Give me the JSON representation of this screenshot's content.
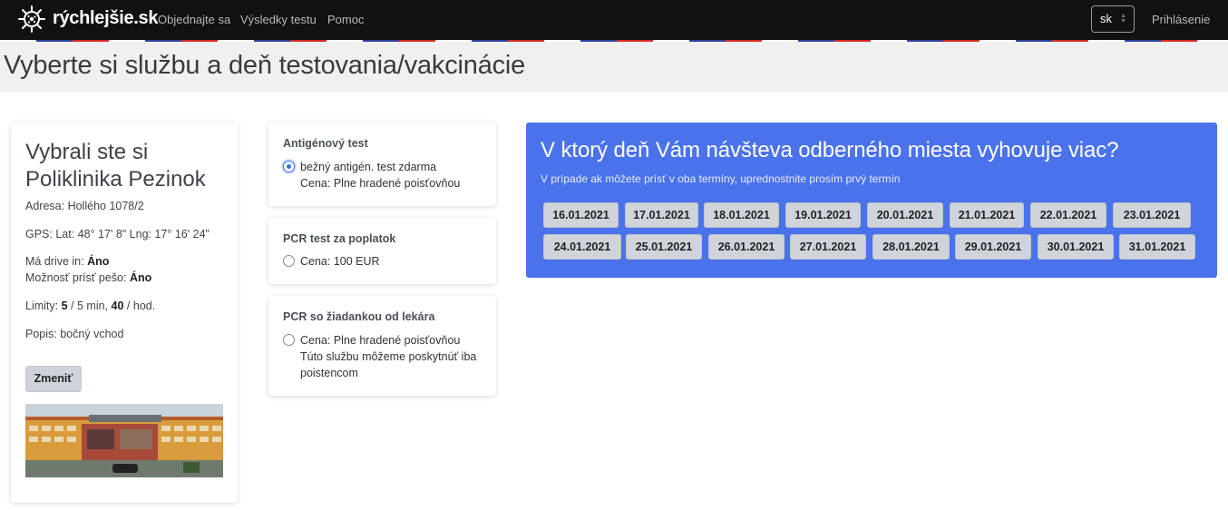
{
  "navbar": {
    "brand": "rýchlejšie.sk",
    "links": [
      "Objednajte sa",
      "Výsledky testu",
      "Pomoc"
    ],
    "language": "sk",
    "login": "Prihlásenie"
  },
  "page_title": "Vyberte si službu a deň testovania/vakcinácie",
  "location": {
    "heading_line1": "Vybrali ste si",
    "heading_line2": "Poliklinika Pezinok",
    "address_label": "Adresa:",
    "address": "Hollého 1078/2",
    "gps_label": "GPS:",
    "gps": "Lat: 48° 17' 8\" Lng: 17° 16' 24\"",
    "drive_in_label": "Má drive in:",
    "drive_in": "Áno",
    "walk_in_label": "Možnosť prísť pešo:",
    "walk_in": "Áno",
    "limits_label": "Limity:",
    "limit_count": "5",
    "limit_rest": "/ 5 min,",
    "limit_hourly": "40",
    "limit_hourly_unit": "/ hod.",
    "description_label": "Popis:",
    "description": "bočný vchod",
    "change_button": "Zmeniť"
  },
  "services": [
    {
      "title": "Antigénový test",
      "selected": true,
      "lines": [
        "bežný antigén. test zdarma",
        "Cena: Plne hradené poisťovňou"
      ]
    },
    {
      "title": "PCR test za poplatok",
      "selected": false,
      "lines": [
        "Cena: 100 EUR"
      ]
    },
    {
      "title": "PCR so žiadankou od lekára",
      "selected": false,
      "lines": [
        "Cena: Plne hradené poisťovňou",
        "Túto službu môžeme poskytnúť iba",
        "poistencom"
      ]
    }
  ],
  "dates": {
    "heading": "V ktorý deň Vám návšteva odberného miesta vyhovuje viac?",
    "subheading": "V prípade ak môžete prísť v oba termíny, uprednostnite prosím prvý termín",
    "row1": [
      "16.01.2021",
      "17.01.2021",
      "18.01.2021",
      "19.01.2021",
      "20.01.2021",
      "21.01.2021",
      "22.01.2021",
      "23.01.2021"
    ],
    "row2": [
      "24.01.2021",
      "25.01.2021",
      "26.01.2021",
      "27.01.2021",
      "28.01.2021",
      "29.01.2021",
      "30.01.2021",
      "31.01.2021"
    ]
  },
  "colors": {
    "navbar": "#111111",
    "date_panel": "#4a72ea",
    "flag_blue": "#2c3e9c",
    "flag_red": "#d52b1e"
  }
}
